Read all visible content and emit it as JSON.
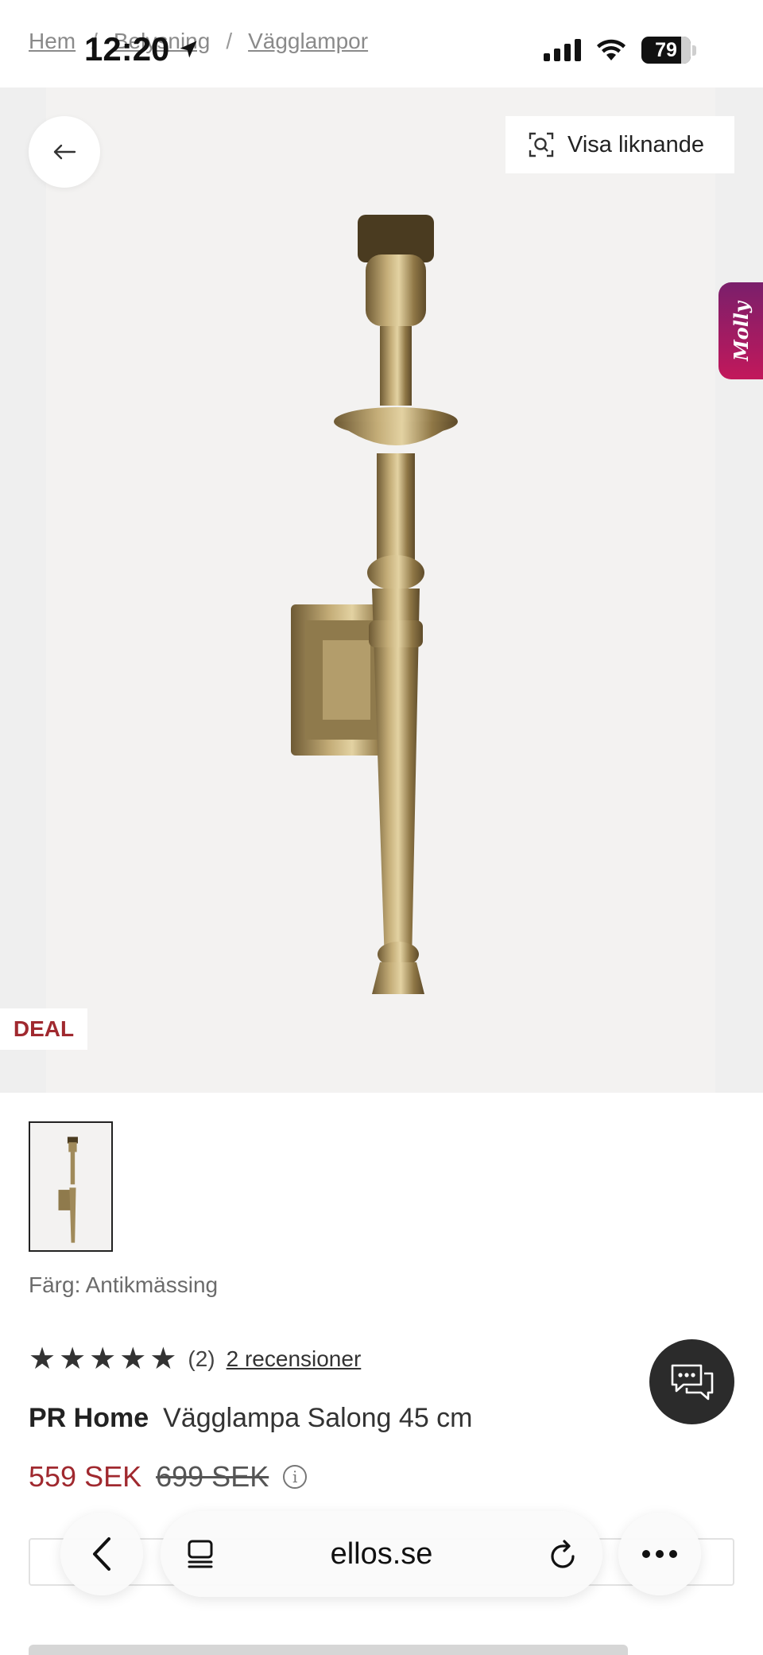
{
  "status_bar": {
    "time": "12:20",
    "battery": "79"
  },
  "breadcrumb": [
    "Hem",
    "Belysning",
    "Vägglampor"
  ],
  "hero": {
    "similar_label": "Visa liknande",
    "molly_label": "Molly",
    "deal_label": "DEAL"
  },
  "product": {
    "color_label": "Färg: Antikmässing",
    "rating_count": "(2)",
    "reviews_link": "2 recensioner",
    "rating_stars": 5,
    "brand": "PR Home",
    "name": "Vägglampa Salong 45 cm",
    "price_now": "559 SEK",
    "price_old": "699 SEK"
  },
  "browser": {
    "url": "ellos.se"
  },
  "colors": {
    "accent_red": "#a0292f",
    "brass": "#a08a5a"
  }
}
